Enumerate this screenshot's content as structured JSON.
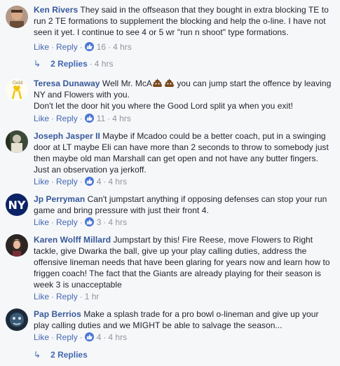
{
  "comments": [
    {
      "author": "Ken Rivers",
      "text": "They said in the offseason that they bought in extra blocking TE to run 2 TE formations to supplement the blocking and help the o-line. I have not seen it yet. I continue to see 4 or 5 wr \"run n shoot\" type formations.",
      "like_label": "Like",
      "reply_label": "Reply",
      "reactions": "16",
      "time": "4 hrs",
      "replies_label": "2 Replies",
      "replies_time": "4 hrs"
    },
    {
      "author": "Teresa Dunaway",
      "text_before_emoji": "Well Mr. McA",
      "text_after_emoji": " you can jump start the offence by leaving NY and Flowers with you.",
      "text_second_line": "Don't let the door hit you where the Good Lord split ya when you exit!",
      "like_label": "Like",
      "reply_label": "Reply",
      "reactions": "11",
      "time": "4 hrs"
    },
    {
      "author": "Joseph Jasper II",
      "text": "Maybe if Mcadoo could be a better coach, put in a swinging door at LT maybe Eli can have more than 2 seconds to throw to somebody just then maybe old man Marshall can get open and not have any butter fingers. Just an observation ya jerkoff.",
      "like_label": "Like",
      "reply_label": "Reply",
      "reactions": "4",
      "time": "4 hrs"
    },
    {
      "author": "Jp Perryman",
      "text": "Can't jumpstart anything if opposing defenses can stop your run game and bring pressure with just their front 4.",
      "like_label": "Like",
      "reply_label": "Reply",
      "reactions": "3",
      "time": "4 hrs"
    },
    {
      "author": "Karen Wolff Millard",
      "text": "Jumpstart by this! Fire Reese, move Flowers to Right tackle, give Dwarka the ball, give up your play calling duties, address the offensive lineman needs that have been glaring for years now and learn how to friggen coach! The fact that the Giants are already playing for their season is week 3 is unacceptable",
      "like_label": "Like",
      "reply_label": "Reply",
      "time": "1 hr"
    },
    {
      "author": "Pap Berrios",
      "text": "Make a splash trade for a pro bowl o-lineman and give up your play calling duties and we MIGHT be able to salvage the season...",
      "like_label": "Like",
      "reply_label": "Reply",
      "reactions": "4",
      "time": "4 hrs",
      "replies_label": "2 Replies"
    }
  ],
  "colors": {
    "author": "#365899",
    "link": "#4267b2",
    "meta": "#90949c",
    "reaction_badge": "#4a76d6"
  },
  "icons": {
    "reaction": "thumbs-up-icon",
    "reply_arrow": "reply-arrow-icon",
    "emoji": "poop-emoji"
  },
  "avatar_badges": {
    "teresa": "Gold",
    "jp": "NY"
  }
}
